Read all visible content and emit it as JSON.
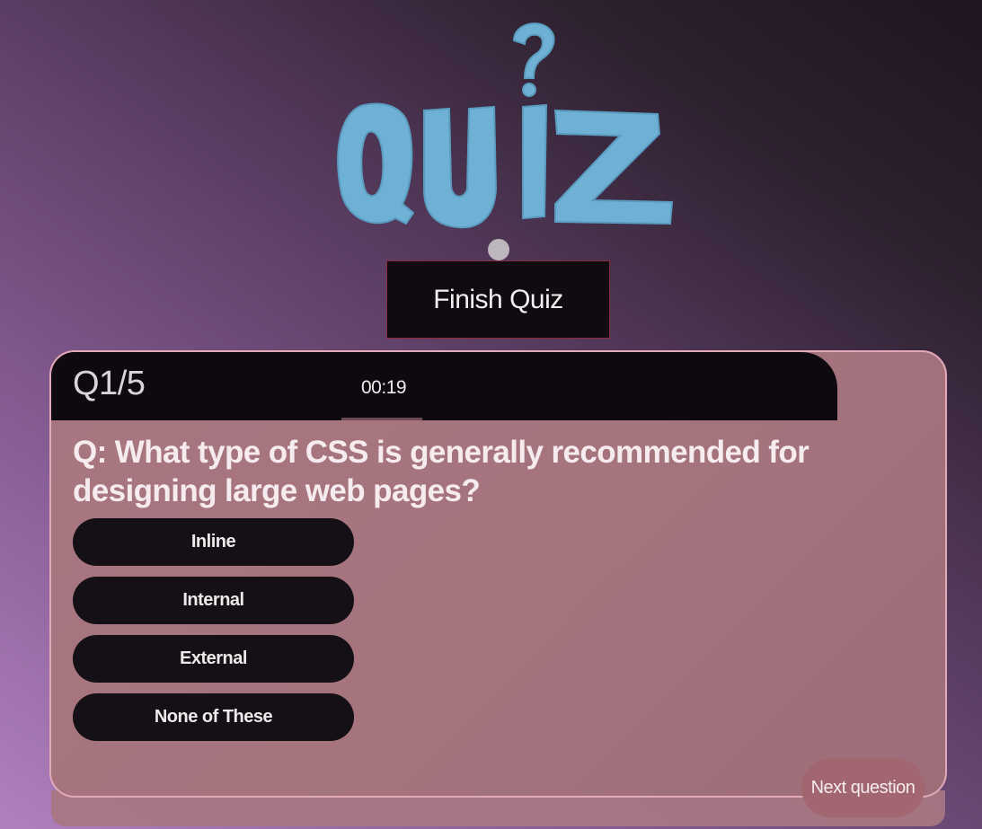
{
  "logo": {
    "text": "QUIZ",
    "icon": "question-mark-icon",
    "color": "#6fb1d4"
  },
  "finish_button": {
    "label": "Finish Quiz"
  },
  "quiz": {
    "question_number": "Q1/5",
    "timer": "00:19",
    "question": "Q: What type of CSS is generally recommended for designing large web pages?",
    "options": [
      "Inline",
      "Internal",
      "External",
      "None of These"
    ],
    "next_label": "Next question"
  },
  "colors": {
    "accent": "#6fb1d4",
    "panel": "#a87680",
    "panel_border": "#e2a9b9",
    "button_dark": "#141015"
  }
}
